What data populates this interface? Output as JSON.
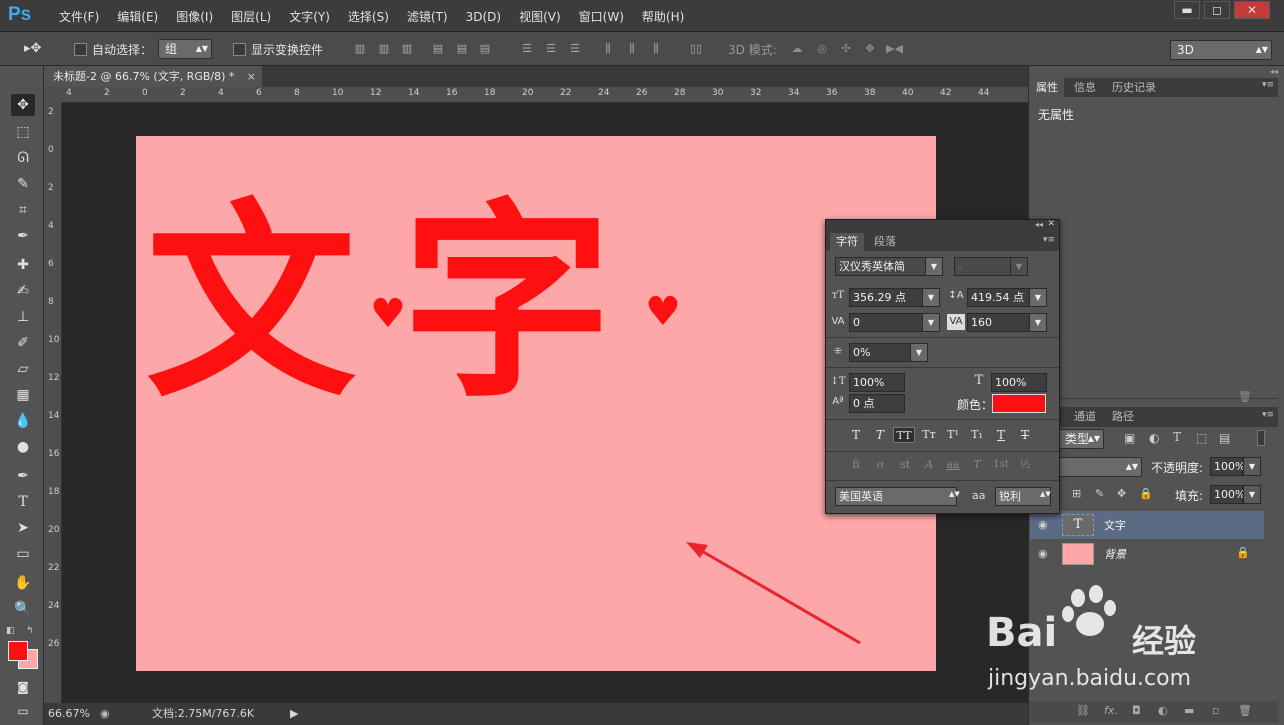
{
  "app": {
    "logo": "Ps"
  },
  "menu": [
    "文件(F)",
    "编辑(E)",
    "图像(I)",
    "图层(L)",
    "文字(Y)",
    "选择(S)",
    "滤镜(T)",
    "3D(D)",
    "视图(V)",
    "窗口(W)",
    "帮助(H)"
  ],
  "window_controls": {
    "minimize": "▬",
    "restore": "◻",
    "close": "✕"
  },
  "options": {
    "auto_select_label": "自动选择：",
    "auto_select_value": "组",
    "show_transform_label": "显示变换控件",
    "mode_3d_label": "3D 模式:",
    "workspace_value": "3D"
  },
  "document_tab": {
    "title": "未标题-2 @ 66.7% (文字, RGB/8) *",
    "close": "×"
  },
  "ruler_top_ticks": [
    "4",
    "2",
    "0",
    "2",
    "4",
    "6",
    "8",
    "10",
    "12",
    "14",
    "16",
    "18",
    "20",
    "22",
    "24",
    "26",
    "28",
    "30",
    "32",
    "34",
    "36",
    "38",
    "40",
    "42",
    "44"
  ],
  "ruler_left_ticks": [
    "2",
    "0",
    "2",
    "4",
    "6",
    "8",
    "10",
    "12",
    "14",
    "16",
    "18",
    "20",
    "22",
    "24",
    "26"
  ],
  "canvas": {
    "text": "文字",
    "text_color": "#ff1010",
    "background_color": "#fea7a8"
  },
  "status": {
    "zoom": "66.67%",
    "doc_info": "文档:2.75M/767.6K"
  },
  "properties_panel": {
    "tabs": [
      "属性",
      "信息",
      "历史记录"
    ],
    "empty_message": "无属性"
  },
  "character_panel": {
    "tabs": [
      "字符",
      "段落"
    ],
    "font_family": "汉仪秀英体简",
    "font_style": "-",
    "font_size": "356.29 点",
    "leading": "419.54 点",
    "kerning": "0",
    "tracking": "160",
    "tsume": "0%",
    "vertical_scale": "100%",
    "horizontal_scale": "100%",
    "baseline_shift": "0 点",
    "color_label": "颜色：",
    "color_value": "#ff1010",
    "style_buttons": [
      "T",
      "T",
      "TT",
      "Tт",
      "T¹",
      "T₁",
      "T",
      "T"
    ],
    "opentype_buttons": [
      "fi",
      "ơ",
      "st",
      "A",
      "aa",
      "T",
      "1st",
      "½"
    ],
    "language": "美国英语",
    "aa_label": "aa",
    "antialias": "锐利"
  },
  "layers_panel": {
    "tabs": [
      "通道",
      "路径"
    ],
    "filter_kind": "类型",
    "opacity_label": "不透明度:",
    "opacity_value": "100%",
    "fill_label": "填充:",
    "fill_value": "100%",
    "layers": [
      {
        "name": "文字",
        "type": "text",
        "selected": true
      },
      {
        "name": "背景",
        "type": "background",
        "locked": true
      }
    ]
  },
  "watermark": {
    "brand": "Bai",
    "brand2": "经验",
    "url": "jingyan.baidu.com"
  }
}
